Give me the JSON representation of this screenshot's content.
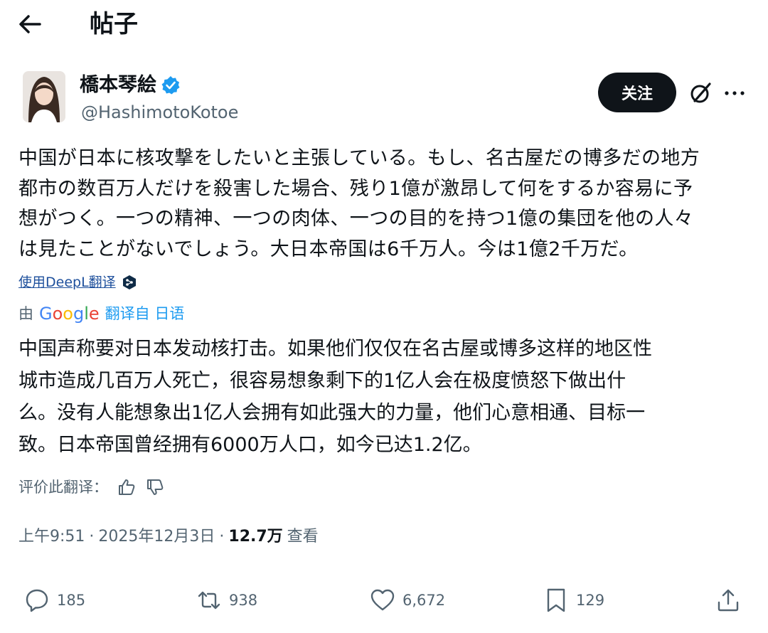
{
  "header": {
    "title": "帖子"
  },
  "author": {
    "name": "橋本琴絵",
    "handle": "@HashimotoKotoe",
    "follow_label": "关注"
  },
  "post": {
    "text": "中国が日本に核攻撃をしたいと主張している。もし、名古屋だの博多だの地方\n都市の数百万人だけを殺害した場合、残り1億が激昂して何をするか容易に予\n想がつく。一つの精神、一つの肉体、一つの目的を持つ1億の集団を他の人々\nは見たことがないでしょう。大日本帝国は6千万人。今は1億2千万だ。",
    "deepl_label": "使用DeepL翻译"
  },
  "translation": {
    "by_prefix": "由",
    "provider": "Google",
    "suffix": "翻译自",
    "language": "日语",
    "text": "中国声称要对日本发动核打击。如果他们仅仅在名古屋或博多这样的地区性\n城市造成几百万人死亡，很容易想象剩下的1亿人会在极度愤怒下做出什\n么。没有人能想象出1亿人会拥有如此强大的力量，他们心意相通、目标一\n致。日本帝国曾经拥有6000万人口，如今已达1.2亿。",
    "rate_label": "评价此翻译："
  },
  "meta": {
    "time": "上午9:51",
    "date": "2025年12月3日",
    "sep": "·",
    "views": "12.7万",
    "views_label": "查看"
  },
  "actions": {
    "replies": "185",
    "reposts": "938",
    "likes": "6,672",
    "bookmarks": "129"
  },
  "colors": {
    "text": "#0f1419",
    "secondary": "#536471",
    "verified": "#1d9bf0",
    "follow_bg": "#0f1419",
    "link": "#1d4f9c"
  },
  "icons": [
    "back-arrow-icon",
    "verified-badge-icon",
    "grok-icon",
    "more-icon",
    "deepl-icon",
    "thumbs-up-icon",
    "thumbs-down-icon",
    "reply-icon",
    "repost-icon",
    "like-icon",
    "bookmark-icon",
    "share-icon"
  ]
}
